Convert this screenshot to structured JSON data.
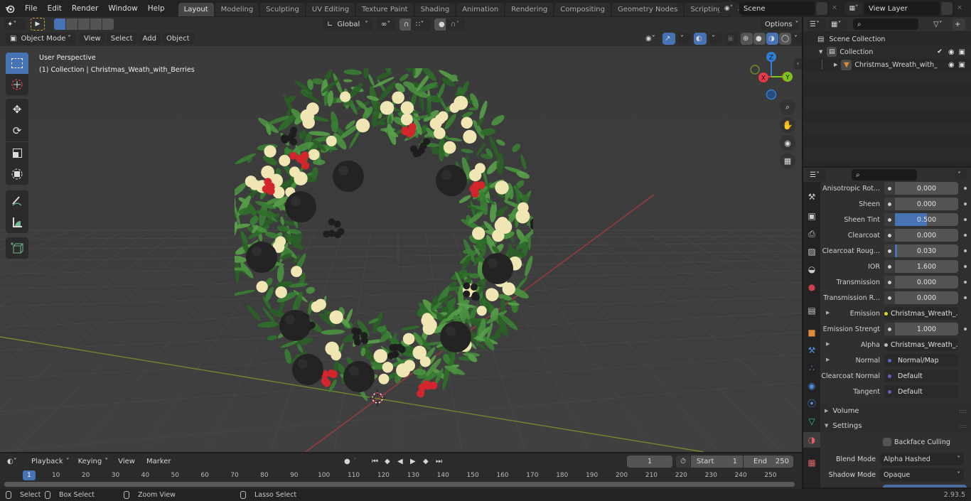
{
  "app": {
    "logo": "blender-logo-icon"
  },
  "menu": [
    "File",
    "Edit",
    "Render",
    "Window",
    "Help"
  ],
  "workspaces": [
    {
      "label": "Layout",
      "active": true
    },
    {
      "label": "Modeling"
    },
    {
      "label": "Sculpting"
    },
    {
      "label": "UV Editing"
    },
    {
      "label": "Texture Paint"
    },
    {
      "label": "Shading"
    },
    {
      "label": "Animation"
    },
    {
      "label": "Rendering"
    },
    {
      "label": "Compositing"
    },
    {
      "label": "Geometry Nodes"
    },
    {
      "label": "Scripting"
    }
  ],
  "scene": {
    "name": "Scene"
  },
  "view_layer": {
    "name": "View Layer"
  },
  "viewport_header": {
    "mode": "Object Mode",
    "menus": [
      "View",
      "Select",
      "Add",
      "Object"
    ],
    "transform_orientation": "Global",
    "options_label": "Options"
  },
  "viewport": {
    "view_name": "User Perspective",
    "object_info": "(1) Collection | Christmas_Weath_with_Berries",
    "gizmo_axes": {
      "x": "X",
      "y": "Y",
      "z": "Z"
    },
    "colors": {
      "x": "#e8394d",
      "y": "#7fc31c",
      "z": "#2f7fd6",
      "grid_x": "#a03a40",
      "grid_y": "#6f8a2a"
    }
  },
  "toolbar": [
    "select-box",
    "cursor",
    "move",
    "rotate",
    "scale",
    "transform",
    "annotate",
    "measure",
    "add-cube"
  ],
  "outliner": {
    "root": "Scene Collection",
    "items": [
      {
        "label": "Collection",
        "level": 1,
        "expanded": true,
        "checkbox": true
      },
      {
        "label": "Christmas_Wreath_with_",
        "level": 2,
        "expanded": false
      }
    ]
  },
  "properties": {
    "rows": [
      {
        "label": "Anisotropic Rot...",
        "value": "0.000",
        "type": "num",
        "fill": 0
      },
      {
        "label": "Sheen",
        "value": "0.000",
        "type": "num",
        "fill": 0
      },
      {
        "label": "Sheen Tint",
        "value": "0.500",
        "type": "num",
        "fill": 0.5
      },
      {
        "label": "Clearcoat",
        "value": "0.000",
        "type": "num",
        "fill": 0
      },
      {
        "label": "Clearcoat Roug...",
        "value": "0.030",
        "type": "num",
        "fill": 0.03
      },
      {
        "label": "IOR",
        "value": "1.600",
        "type": "num",
        "fill": 0
      },
      {
        "label": "Transmission",
        "value": "0.000",
        "type": "num",
        "fill": 0
      },
      {
        "label": "Transmission R...",
        "value": "0.000",
        "type": "num",
        "fill": 0
      },
      {
        "label": "Emission",
        "value": "Christmas_Wreath_...",
        "type": "link",
        "socket": "#d6d62a",
        "arrow": true
      },
      {
        "label": "Emission Strengt",
        "value": "1.000",
        "type": "num",
        "fill": 0
      },
      {
        "label": "Alpha",
        "value": "Christmas_Wreath_...",
        "type": "link",
        "socket": "#bdbdbd",
        "arrow": true
      },
      {
        "label": "Normal",
        "value": "Normal/Map",
        "type": "link",
        "socket": "#6363c7",
        "arrow": true
      },
      {
        "label": "Clearcoat Normal",
        "value": "Default",
        "type": "link",
        "socket": "#6363c7"
      },
      {
        "label": "Tangent",
        "value": "Default",
        "type": "link",
        "socket": "#6363c7"
      }
    ],
    "panels": [
      {
        "label": "Volume",
        "open": false
      },
      {
        "label": "Settings",
        "open": true
      }
    ],
    "backface_culling": "Backface Culling",
    "blend_mode": {
      "label": "Blend Mode",
      "value": "Alpha Hashed"
    },
    "shadow_mode": {
      "label": "Shadow Mode",
      "value": "Opaque"
    }
  },
  "timeline": {
    "menus": [
      "Playback",
      "Keying",
      "View",
      "Marker"
    ],
    "current_frame": "1",
    "start_label": "Start",
    "start": "1",
    "end_label": "End",
    "end": "250",
    "ticks": [
      "1",
      "10",
      "20",
      "30",
      "40",
      "50",
      "60",
      "70",
      "80",
      "90",
      "100",
      "110",
      "120",
      "130",
      "140",
      "150",
      "160",
      "170",
      "180",
      "190",
      "200",
      "210",
      "220",
      "230",
      "240",
      "250"
    ]
  },
  "statusbar": {
    "items": [
      {
        "label": "Select",
        "icon": "mouse-left-icon"
      },
      {
        "label": "Box Select",
        "icon": "mouse-drag-icon"
      },
      {
        "label": "Zoom View",
        "icon": "mouse-middle-icon"
      },
      {
        "label": "Lasso Select",
        "icon": "mouse-right-drag-icon"
      }
    ],
    "version": "2.93.5"
  }
}
